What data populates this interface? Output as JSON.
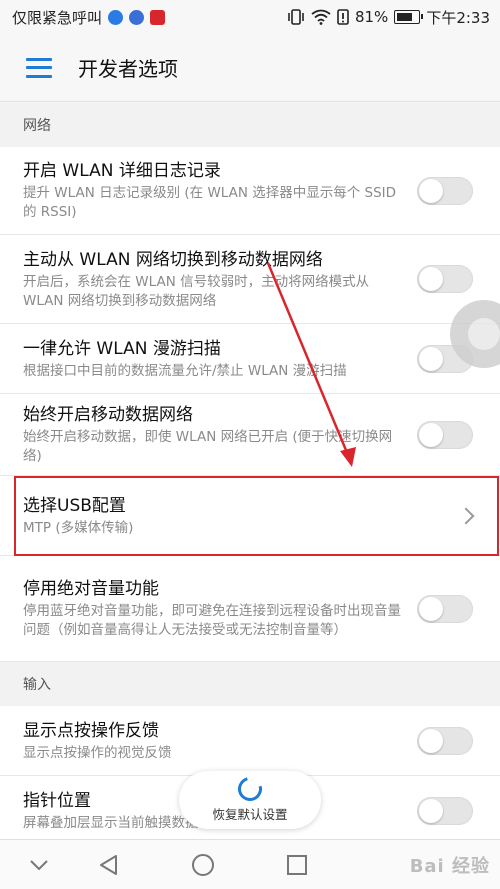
{
  "status_bar": {
    "left_text": "仅限紧急呼叫",
    "battery": "81%",
    "battery_fraction": 0.81,
    "time": "下午2:33",
    "icons": [
      "paw-icon",
      "music-icon",
      "huawei-icon",
      "vibrate-icon",
      "wifi-icon",
      "signal-alert-icon",
      "battery-icon"
    ]
  },
  "app_bar": {
    "title": "开发者选项",
    "menu_icon": "hamburger-menu-icon"
  },
  "accent_color": "#1e7bd6",
  "highlight_color": "#d9262c",
  "sections": [
    {
      "header": "网络",
      "items": [
        {
          "title": "开启 WLAN 详细日志记录",
          "subtitle": "提升 WLAN 日志记录级别 (在 WLAN 选择器中显示每个 SSID 的 RSSI)",
          "control": "toggle",
          "on": false
        },
        {
          "title": "主动从 WLAN 网络切换到移动数据网络",
          "subtitle": "开启后，系统会在 WLAN 信号较弱时，主动将网络模式从 WLAN 网络切换到移动数据网络",
          "control": "toggle",
          "on": false
        },
        {
          "title": "一律允许 WLAN 漫游扫描",
          "subtitle": "根据接口中目前的数据流量允许/禁止 WLAN 漫游扫描",
          "control": "toggle",
          "on": false
        },
        {
          "title": "始终开启移动数据网络",
          "subtitle": "始终开启移动数据，即使 WLAN 网络已开启 (便于快速切换网络)",
          "control": "toggle",
          "on": false
        },
        {
          "title": "选择USB配置",
          "subtitle": "MTP (多媒体传输)",
          "control": "chevron"
        },
        {
          "title": "停用绝对音量功能",
          "subtitle": "停用蓝牙绝对音量功能，即可避免在连接到远程设备时出现音量问题（例如音量高得让人无法接受或无法控制音量等）",
          "control": "toggle",
          "on": false
        }
      ]
    },
    {
      "header": "输入",
      "items": [
        {
          "title": "显示点按操作反馈",
          "subtitle": "显示点按操作的视觉反馈",
          "control": "toggle",
          "on": false
        },
        {
          "title": "指针位置",
          "subtitle": "屏幕叠加层显示当前触摸数据",
          "control": "toggle",
          "on": false
        }
      ]
    }
  ],
  "restore_button": {
    "label": "恢复默认设置"
  },
  "nav_bar": {
    "buttons": [
      "chevron-down-icon",
      "back-triangle-icon",
      "home-circle-icon",
      "recents-square-icon"
    ],
    "watermark": "Bai 经验"
  }
}
